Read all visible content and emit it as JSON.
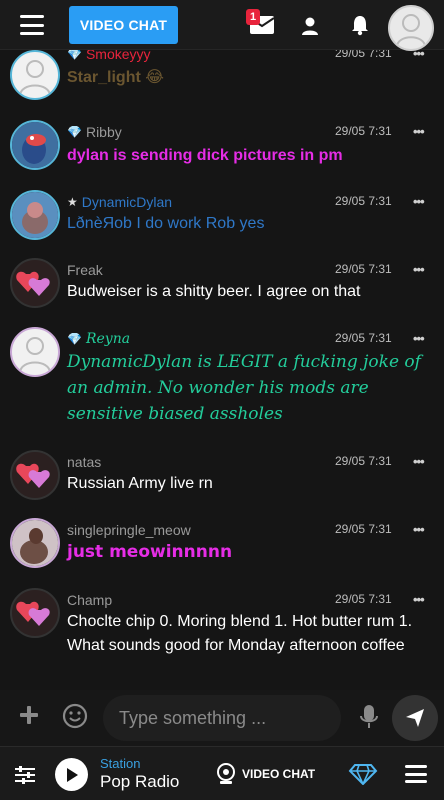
{
  "topbar": {
    "video_chat_label": "VIDEO CHAT",
    "mail_badge": "1"
  },
  "messages": [
    {
      "username": "Smokeyyy",
      "rank_icon": "diamond-icon",
      "timestamp": "29/05 7:31",
      "text": "Star_light 😂",
      "text_color": "#6b5630",
      "name_color": "#e8243c",
      "avatar": "default-user-avatar"
    },
    {
      "username": "Ribby",
      "rank_icon": "diamond-icon",
      "timestamp": "29/05 7:31",
      "text": "dylan is sending dick pictures in pm",
      "text_color": "#e62de6",
      "name_color": "#9a9a9a",
      "avatar": "photo-avatar"
    },
    {
      "username": "DynamicDylan",
      "rank_icon": "star-icon",
      "timestamp": "29/05 7:31",
      "text": "LðnèЯob I do work Rob yes",
      "text_color": "#2f78c8",
      "name_color": "#2f78c8",
      "avatar": "photo-avatar"
    },
    {
      "username": "Freak",
      "rank_icon": "",
      "timestamp": "29/05 7:31",
      "text": "Budweiser is a shitty beer. I agree on that",
      "text_color": "#ffffff",
      "name_color": "#9a9a9a",
      "avatar": "heart-avatar"
    },
    {
      "username": "Reyna",
      "rank_icon": "diamond-icon",
      "timestamp": "29/05 7:31",
      "text": "DynamicDylan is LEGIT a fucking joke of an admin. No wonder his mods are sensitive biased assholes",
      "text_color": "#23cd9b",
      "name_color": "#23cd9b",
      "avatar": "default-user-avatar"
    },
    {
      "username": "natas",
      "rank_icon": "",
      "timestamp": "29/05 7:31",
      "text": "Russian Army live rn",
      "text_color": "#ffffff",
      "name_color": "#9a9a9a",
      "avatar": "heart-avatar"
    },
    {
      "username": "singlepringle_meow",
      "rank_icon": "",
      "timestamp": "29/05 7:31",
      "text": "just meowinnnnn",
      "text_color": "#e62de6",
      "name_color": "#9a9a9a",
      "avatar": "photo-avatar"
    },
    {
      "username": "Champ",
      "rank_icon": "",
      "timestamp": "29/05 7:31",
      "text": "Choclte chip 0. Moring blend 1. Hot butter rum 1. What sounds good for Monday afternoon coffee",
      "text_color": "#ffffff",
      "name_color": "#9a9a9a",
      "avatar": "heart-avatar"
    }
  ],
  "composer": {
    "placeholder": "Type something ..."
  },
  "player": {
    "station_label": "Station",
    "station_name": "Pop Radio",
    "video_chat_label": "VIDEO CHAT"
  },
  "colors": {
    "accent": "#2a9df4",
    "badge": "#e8243c",
    "background": "#151515"
  }
}
